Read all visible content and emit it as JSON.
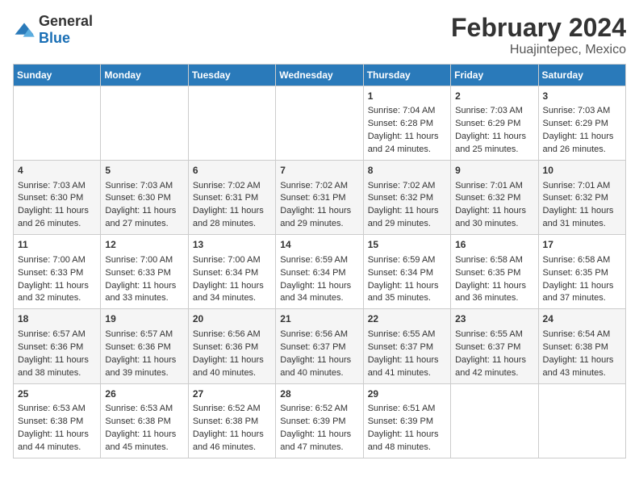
{
  "header": {
    "logo_general": "General",
    "logo_blue": "Blue",
    "title": "February 2024",
    "location": "Huajintepec, Mexico"
  },
  "days_of_week": [
    "Sunday",
    "Monday",
    "Tuesday",
    "Wednesday",
    "Thursday",
    "Friday",
    "Saturday"
  ],
  "weeks": [
    [
      {
        "day": "",
        "content": ""
      },
      {
        "day": "",
        "content": ""
      },
      {
        "day": "",
        "content": ""
      },
      {
        "day": "",
        "content": ""
      },
      {
        "day": "1",
        "content": "Sunrise: 7:04 AM\nSunset: 6:28 PM\nDaylight: 11 hours\nand 24 minutes."
      },
      {
        "day": "2",
        "content": "Sunrise: 7:03 AM\nSunset: 6:29 PM\nDaylight: 11 hours\nand 25 minutes."
      },
      {
        "day": "3",
        "content": "Sunrise: 7:03 AM\nSunset: 6:29 PM\nDaylight: 11 hours\nand 26 minutes."
      }
    ],
    [
      {
        "day": "4",
        "content": "Sunrise: 7:03 AM\nSunset: 6:30 PM\nDaylight: 11 hours\nand 26 minutes."
      },
      {
        "day": "5",
        "content": "Sunrise: 7:03 AM\nSunset: 6:30 PM\nDaylight: 11 hours\nand 27 minutes."
      },
      {
        "day": "6",
        "content": "Sunrise: 7:02 AM\nSunset: 6:31 PM\nDaylight: 11 hours\nand 28 minutes."
      },
      {
        "day": "7",
        "content": "Sunrise: 7:02 AM\nSunset: 6:31 PM\nDaylight: 11 hours\nand 29 minutes."
      },
      {
        "day": "8",
        "content": "Sunrise: 7:02 AM\nSunset: 6:32 PM\nDaylight: 11 hours\nand 29 minutes."
      },
      {
        "day": "9",
        "content": "Sunrise: 7:01 AM\nSunset: 6:32 PM\nDaylight: 11 hours\nand 30 minutes."
      },
      {
        "day": "10",
        "content": "Sunrise: 7:01 AM\nSunset: 6:32 PM\nDaylight: 11 hours\nand 31 minutes."
      }
    ],
    [
      {
        "day": "11",
        "content": "Sunrise: 7:00 AM\nSunset: 6:33 PM\nDaylight: 11 hours\nand 32 minutes."
      },
      {
        "day": "12",
        "content": "Sunrise: 7:00 AM\nSunset: 6:33 PM\nDaylight: 11 hours\nand 33 minutes."
      },
      {
        "day": "13",
        "content": "Sunrise: 7:00 AM\nSunset: 6:34 PM\nDaylight: 11 hours\nand 34 minutes."
      },
      {
        "day": "14",
        "content": "Sunrise: 6:59 AM\nSunset: 6:34 PM\nDaylight: 11 hours\nand 34 minutes."
      },
      {
        "day": "15",
        "content": "Sunrise: 6:59 AM\nSunset: 6:34 PM\nDaylight: 11 hours\nand 35 minutes."
      },
      {
        "day": "16",
        "content": "Sunrise: 6:58 AM\nSunset: 6:35 PM\nDaylight: 11 hours\nand 36 minutes."
      },
      {
        "day": "17",
        "content": "Sunrise: 6:58 AM\nSunset: 6:35 PM\nDaylight: 11 hours\nand 37 minutes."
      }
    ],
    [
      {
        "day": "18",
        "content": "Sunrise: 6:57 AM\nSunset: 6:36 PM\nDaylight: 11 hours\nand 38 minutes."
      },
      {
        "day": "19",
        "content": "Sunrise: 6:57 AM\nSunset: 6:36 PM\nDaylight: 11 hours\nand 39 minutes."
      },
      {
        "day": "20",
        "content": "Sunrise: 6:56 AM\nSunset: 6:36 PM\nDaylight: 11 hours\nand 40 minutes."
      },
      {
        "day": "21",
        "content": "Sunrise: 6:56 AM\nSunset: 6:37 PM\nDaylight: 11 hours\nand 40 minutes."
      },
      {
        "day": "22",
        "content": "Sunrise: 6:55 AM\nSunset: 6:37 PM\nDaylight: 11 hours\nand 41 minutes."
      },
      {
        "day": "23",
        "content": "Sunrise: 6:55 AM\nSunset: 6:37 PM\nDaylight: 11 hours\nand 42 minutes."
      },
      {
        "day": "24",
        "content": "Sunrise: 6:54 AM\nSunset: 6:38 PM\nDaylight: 11 hours\nand 43 minutes."
      }
    ],
    [
      {
        "day": "25",
        "content": "Sunrise: 6:53 AM\nSunset: 6:38 PM\nDaylight: 11 hours\nand 44 minutes."
      },
      {
        "day": "26",
        "content": "Sunrise: 6:53 AM\nSunset: 6:38 PM\nDaylight: 11 hours\nand 45 minutes."
      },
      {
        "day": "27",
        "content": "Sunrise: 6:52 AM\nSunset: 6:38 PM\nDaylight: 11 hours\nand 46 minutes."
      },
      {
        "day": "28",
        "content": "Sunrise: 6:52 AM\nSunset: 6:39 PM\nDaylight: 11 hours\nand 47 minutes."
      },
      {
        "day": "29",
        "content": "Sunrise: 6:51 AM\nSunset: 6:39 PM\nDaylight: 11 hours\nand 48 minutes."
      },
      {
        "day": "",
        "content": ""
      },
      {
        "day": "",
        "content": ""
      }
    ]
  ]
}
